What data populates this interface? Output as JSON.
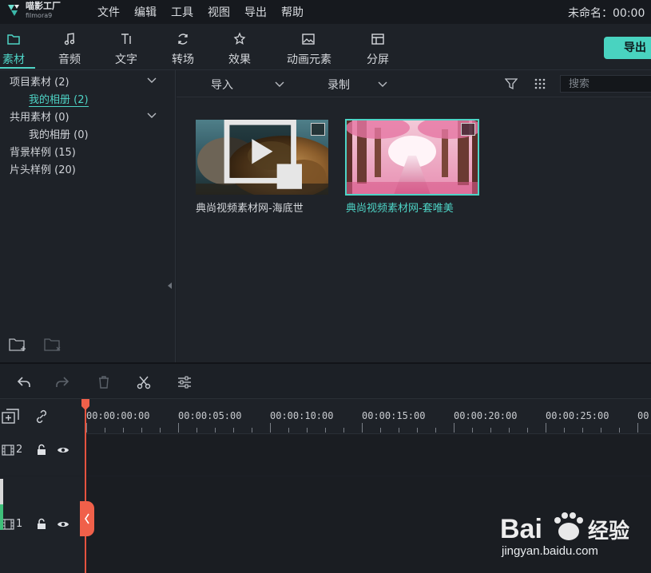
{
  "app": {
    "logo_name": "喵影工厂",
    "logo_sub": "filmora9",
    "doc_title": "未命名：00:00"
  },
  "menu": [
    "文件",
    "编辑",
    "工具",
    "视图",
    "导出",
    "帮助"
  ],
  "tabs": [
    {
      "label": "素材",
      "icon": "folder-icon",
      "active": true
    },
    {
      "label": "音频",
      "icon": "music-note-icon",
      "active": false
    },
    {
      "label": "文字",
      "icon": "text-icon",
      "active": false
    },
    {
      "label": "转场",
      "icon": "transition-icon",
      "active": false
    },
    {
      "label": "效果",
      "icon": "effects-icon",
      "active": false
    },
    {
      "label": "动画元素",
      "icon": "image-icon",
      "active": false
    },
    {
      "label": "分屏",
      "icon": "split-screen-icon",
      "active": false
    }
  ],
  "export_label": "导出",
  "library_tree": [
    {
      "label": "项目素材 (2)",
      "level": 0,
      "expandable": true
    },
    {
      "label": "我的相册 (2)",
      "level": 1,
      "selected": true
    },
    {
      "label": "共用素材 (0)",
      "level": 0,
      "expandable": true
    },
    {
      "label": "我的相册 (0)",
      "level": 1
    },
    {
      "label": "背景样例 (15)",
      "level": 0
    },
    {
      "label": "片头样例 (20)",
      "level": 0
    }
  ],
  "library_bar": {
    "import_label": "导入",
    "record_label": "录制",
    "search_placeholder": "搜索"
  },
  "clips": [
    {
      "name": "典尚视频素材网-海底世",
      "selected": false
    },
    {
      "name": "典尚视频素材网-套唯美",
      "selected": true
    }
  ],
  "timeline": {
    "ruler": [
      "00:00:00:00",
      "00:00:05:00",
      "00:00:10:00",
      "00:00:15:00",
      "00:00:20:00",
      "00:00:25:00",
      "00"
    ],
    "tracks": [
      {
        "number": "2"
      },
      {
        "number": "1"
      }
    ]
  },
  "watermark": {
    "brand": "Bai 经验",
    "url": "jingyan.baidu.com"
  },
  "colors": {
    "accent": "#4ed4c6",
    "playhead": "#e5533f",
    "background": "#1c2026"
  }
}
